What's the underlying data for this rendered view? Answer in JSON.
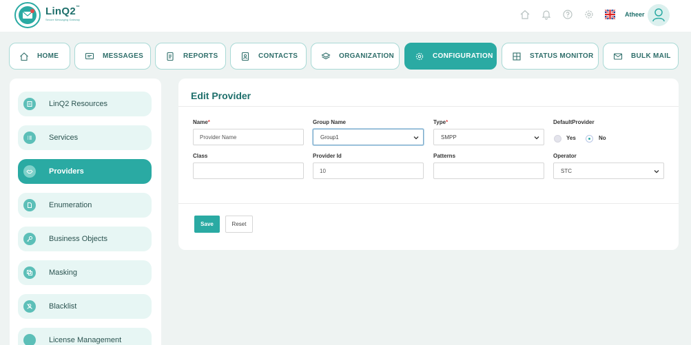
{
  "brand": {
    "name": "LinQ2",
    "tm": "™",
    "tagline": "Secure Messaging Gateway"
  },
  "header": {
    "user_name": "Atheer",
    "icons": [
      "home-icon",
      "bell-icon",
      "help-icon",
      "settings-icon",
      "uk-flag-icon",
      "user-avatar-icon"
    ]
  },
  "nav": {
    "tabs": [
      {
        "label": "HOME",
        "icon": "home-icon"
      },
      {
        "label": "MESSAGES",
        "icon": "message-icon"
      },
      {
        "label": "REPORTS",
        "icon": "report-icon"
      },
      {
        "label": "CONTACTS",
        "icon": "contacts-icon"
      },
      {
        "label": "ORGANIZATION",
        "icon": "layers-icon"
      },
      {
        "label": "CONFIGURATION",
        "icon": "gear-icon",
        "active": true
      },
      {
        "label": "STATUS MONITOR",
        "icon": "grid-icon"
      },
      {
        "label": "BULK MAIL",
        "icon": "mail-icon"
      }
    ]
  },
  "sidebar": {
    "items": [
      {
        "label": "LinQ2 Resources",
        "icon": "resources-icon"
      },
      {
        "label": "Services",
        "icon": "list-icon"
      },
      {
        "label": "Providers",
        "icon": "handshake-icon",
        "active": true
      },
      {
        "label": "Enumeration",
        "icon": "document-icon"
      },
      {
        "label": "Business Objects",
        "icon": "key-icon"
      },
      {
        "label": "Masking",
        "icon": "copy-icon"
      },
      {
        "label": "Blacklist",
        "icon": "block-user-icon"
      },
      {
        "label": "License Management",
        "icon": "license-icon"
      }
    ]
  },
  "form": {
    "title": "Edit Provider",
    "name": {
      "label": "Name",
      "required": "*",
      "placeholder": "Provider Name",
      "value": ""
    },
    "group_name": {
      "label": "Group Name",
      "value": "Group1"
    },
    "type": {
      "label": "Type",
      "required": "*",
      "value": "SMPP"
    },
    "default_provider": {
      "label": "DefaultProvider",
      "yes": "Yes",
      "no": "No",
      "selected": "No"
    },
    "class": {
      "label": "Class",
      "value": ""
    },
    "provider_id": {
      "label": "Provider Id",
      "value": "10"
    },
    "patterns": {
      "label": "Patterns",
      "value": ""
    },
    "operator": {
      "label": "Operator",
      "value": "STC"
    },
    "save_label": "Save",
    "reset_label": "Reset"
  },
  "colors": {
    "accent": "#2aaaa3",
    "brand_text": "#1e6f6b",
    "background": "#eef3f2"
  }
}
